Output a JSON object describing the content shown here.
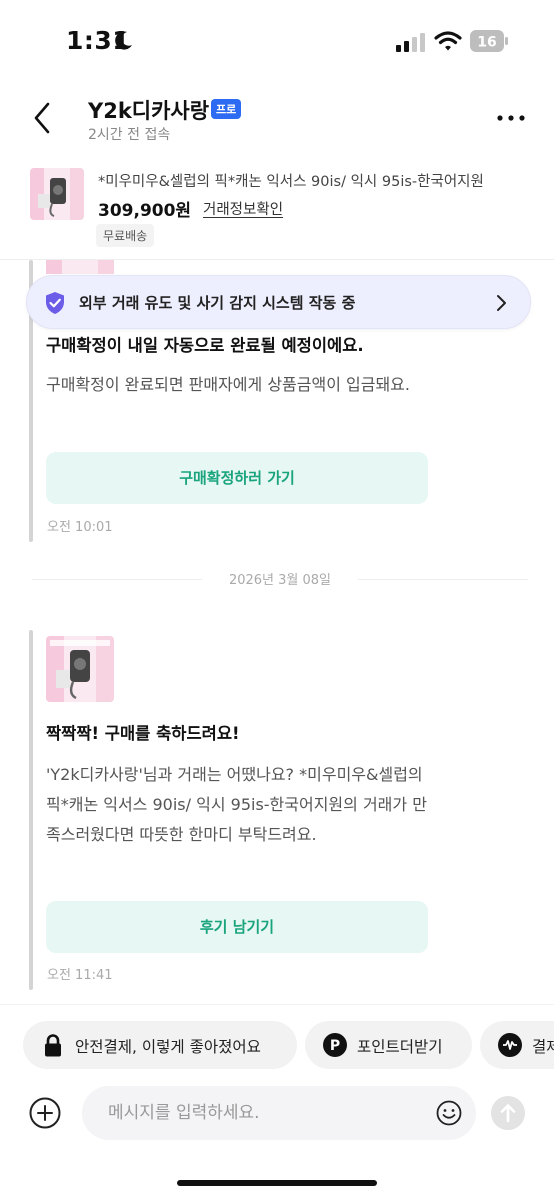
{
  "status_bar": {
    "time": "1:31",
    "battery": "16"
  },
  "header": {
    "shop_name": "Y2k디카사랑",
    "badge": "프로",
    "last_seen": "2시간 전 접속"
  },
  "product": {
    "title": "*미우미우&셀럽의 픽*캐논 익서스 90is/ 익시 95is-한국어지원",
    "price": "309,900원",
    "trade_info_link": "거래정보확인",
    "shipping_tag": "무료배송"
  },
  "fraud_banner": {
    "text": "외부 거래 유도 및 사기 감지 시스템 작동 중"
  },
  "messages": [
    {
      "title": "구매확정이 내일 자동으로 완료될 예정이에요.",
      "body": "구매확정이 완료되면 판매자에게 상품금액이 입금돼요.",
      "button": "구매확정하러 가기",
      "time": "오전 10:01"
    },
    {
      "title": "짝짝짝! 구매를 축하드려요!",
      "body": "'Y2k디카사랑'님과 거래는 어땠나요? *미우미우&셀럽의 픽*캐논 익서스 90is/ 익시 95is-한국어지원의 거래가 만족스러웠다면 따뜻한 한마디 부탁드려요.",
      "button": "후기 남기기",
      "time": "오전 11:41"
    }
  ],
  "date_divider": "2026년 3월 08일",
  "quick_replies": [
    {
      "label": "안전결제, 이렇게 좋아졌어요",
      "icon": "lock-icon"
    },
    {
      "label": "포인트더받기",
      "icon": "point-icon"
    },
    {
      "label": "결제",
      "icon": "pay-icon"
    }
  ],
  "composer": {
    "placeholder": "메시지를 입력하세요."
  },
  "colors": {
    "accent_green": "#19a47e",
    "badge_blue": "#2d6bf2",
    "banner_bg": "#eeeffe",
    "button_bg": "#e7f7f3"
  }
}
